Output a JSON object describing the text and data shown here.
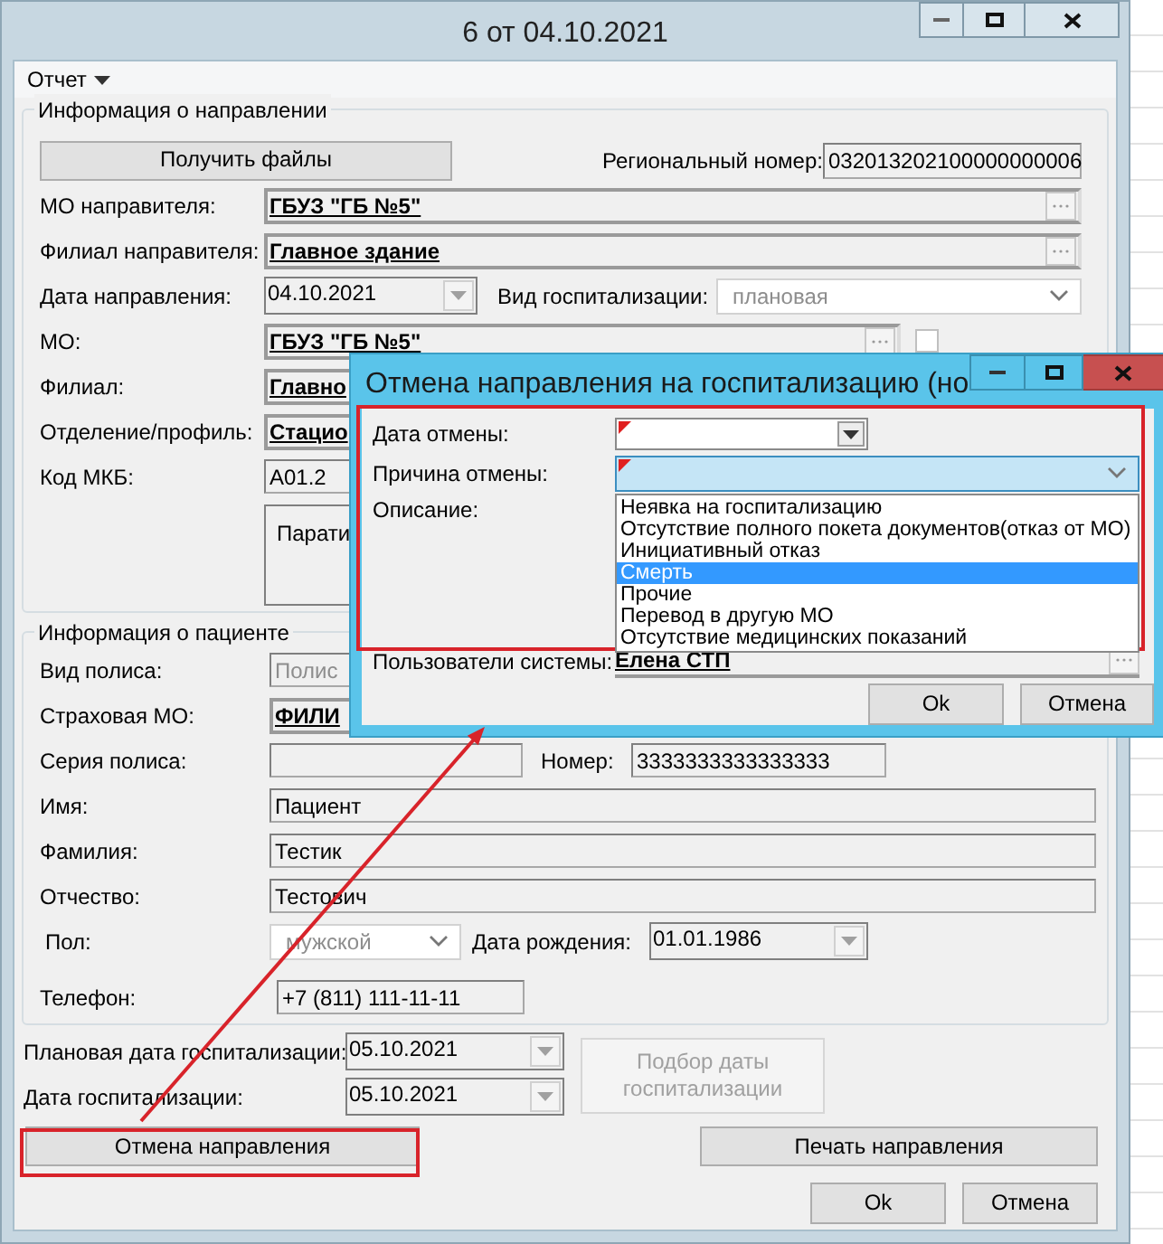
{
  "window": {
    "title": "6 от 04.10.2021"
  },
  "menu": [
    {
      "label": "Отчет"
    }
  ],
  "referral": {
    "title": "Информация о направлении",
    "get_files_button": "Получить файлы",
    "regional_number": {
      "label": "Региональный номер:",
      "value": "032013202100000000006"
    },
    "sender_mo": {
      "label": "МО направителя:",
      "value": "ГБУЗ \"ГБ №5\""
    },
    "sender_branch": {
      "label": "Филиал направителя:",
      "value": "Главное здание"
    },
    "referral_date": {
      "label": "Дата направления:",
      "value": "04.10.2021"
    },
    "hospitalization_type": {
      "label": "Вид госпитализации:",
      "value": "плановая"
    },
    "mo": {
      "label": "МО:",
      "value": "ГБУЗ \"ГБ №5\""
    },
    "other_region": {
      "checked": false
    },
    "branch": {
      "label": "Филиал:",
      "value": "Главно"
    },
    "department": {
      "label": "Отделение/профиль:",
      "value": "Стацио"
    },
    "icd_code": {
      "label": "Код МКБ:",
      "value": "A01.2"
    },
    "description": "Парати"
  },
  "patient": {
    "title": "Информация о пациенте",
    "policy_type": {
      "label": "Вид полиса:",
      "value": "Полис",
      "disabled": true
    },
    "insurer": {
      "label": "Страховая МО:",
      "value": "ФИЛИ"
    },
    "policy_series": {
      "label": "Серия полиса:"
    },
    "policy_number": {
      "label": "Номер:",
      "value": "3333333333333333"
    },
    "first_name": {
      "label": "Имя:",
      "value": "Пациент"
    },
    "last_name": {
      "label": "Фамилия:",
      "value": "Тестик"
    },
    "patronymic": {
      "label": "Отчество:",
      "value": "Тестович"
    },
    "sex": {
      "label": "Пол:",
      "value": "мужской"
    },
    "birth_date": {
      "label": "Дата рождения:",
      "value": "01.01.1986"
    },
    "phone": {
      "label": "Телефон:",
      "value": "+7 (811) 111-11-11"
    }
  },
  "planned_date": {
    "label": "Плановая дата госпитализации:",
    "value": "05.10.2021"
  },
  "hospitalization_date": {
    "label": "Дата госпитализации:",
    "value": "05.10.2021"
  },
  "pick_date_button": {
    "label": "Подбор даты госпитализации",
    "disabled": true
  },
  "cancel_referral_button": "Отмена направления",
  "print_referral_button": "Печать направления",
  "ok_button": "Ok",
  "cancel_button": "Отмена",
  "dialog": {
    "title": "Отмена направления на госпитализацию (но",
    "cancel_date": {
      "label": "Дата отмены:",
      "required": true
    },
    "reason": {
      "label": "Причина отмены:",
      "required": true,
      "expanded": true,
      "options": [
        {
          "label": "Неявка на госпитализацию",
          "selected": false
        },
        {
          "label": "Отсутствие полного покета документов(отказ от МО)",
          "selected": false
        },
        {
          "label": "Инициативный отказ",
          "selected": false
        },
        {
          "label": "Смерть",
          "selected": true
        },
        {
          "label": "Прочие",
          "selected": false
        },
        {
          "label": "Перевод в другую МО",
          "selected": false
        },
        {
          "label": "Отсутствие медицинских показаний",
          "selected": false
        }
      ]
    },
    "description_label": "Описание:",
    "users": {
      "label": "Пользователи системы:",
      "value": "Елена СТП"
    },
    "ok_button": "Ok",
    "cancel_button": "Отмена"
  }
}
